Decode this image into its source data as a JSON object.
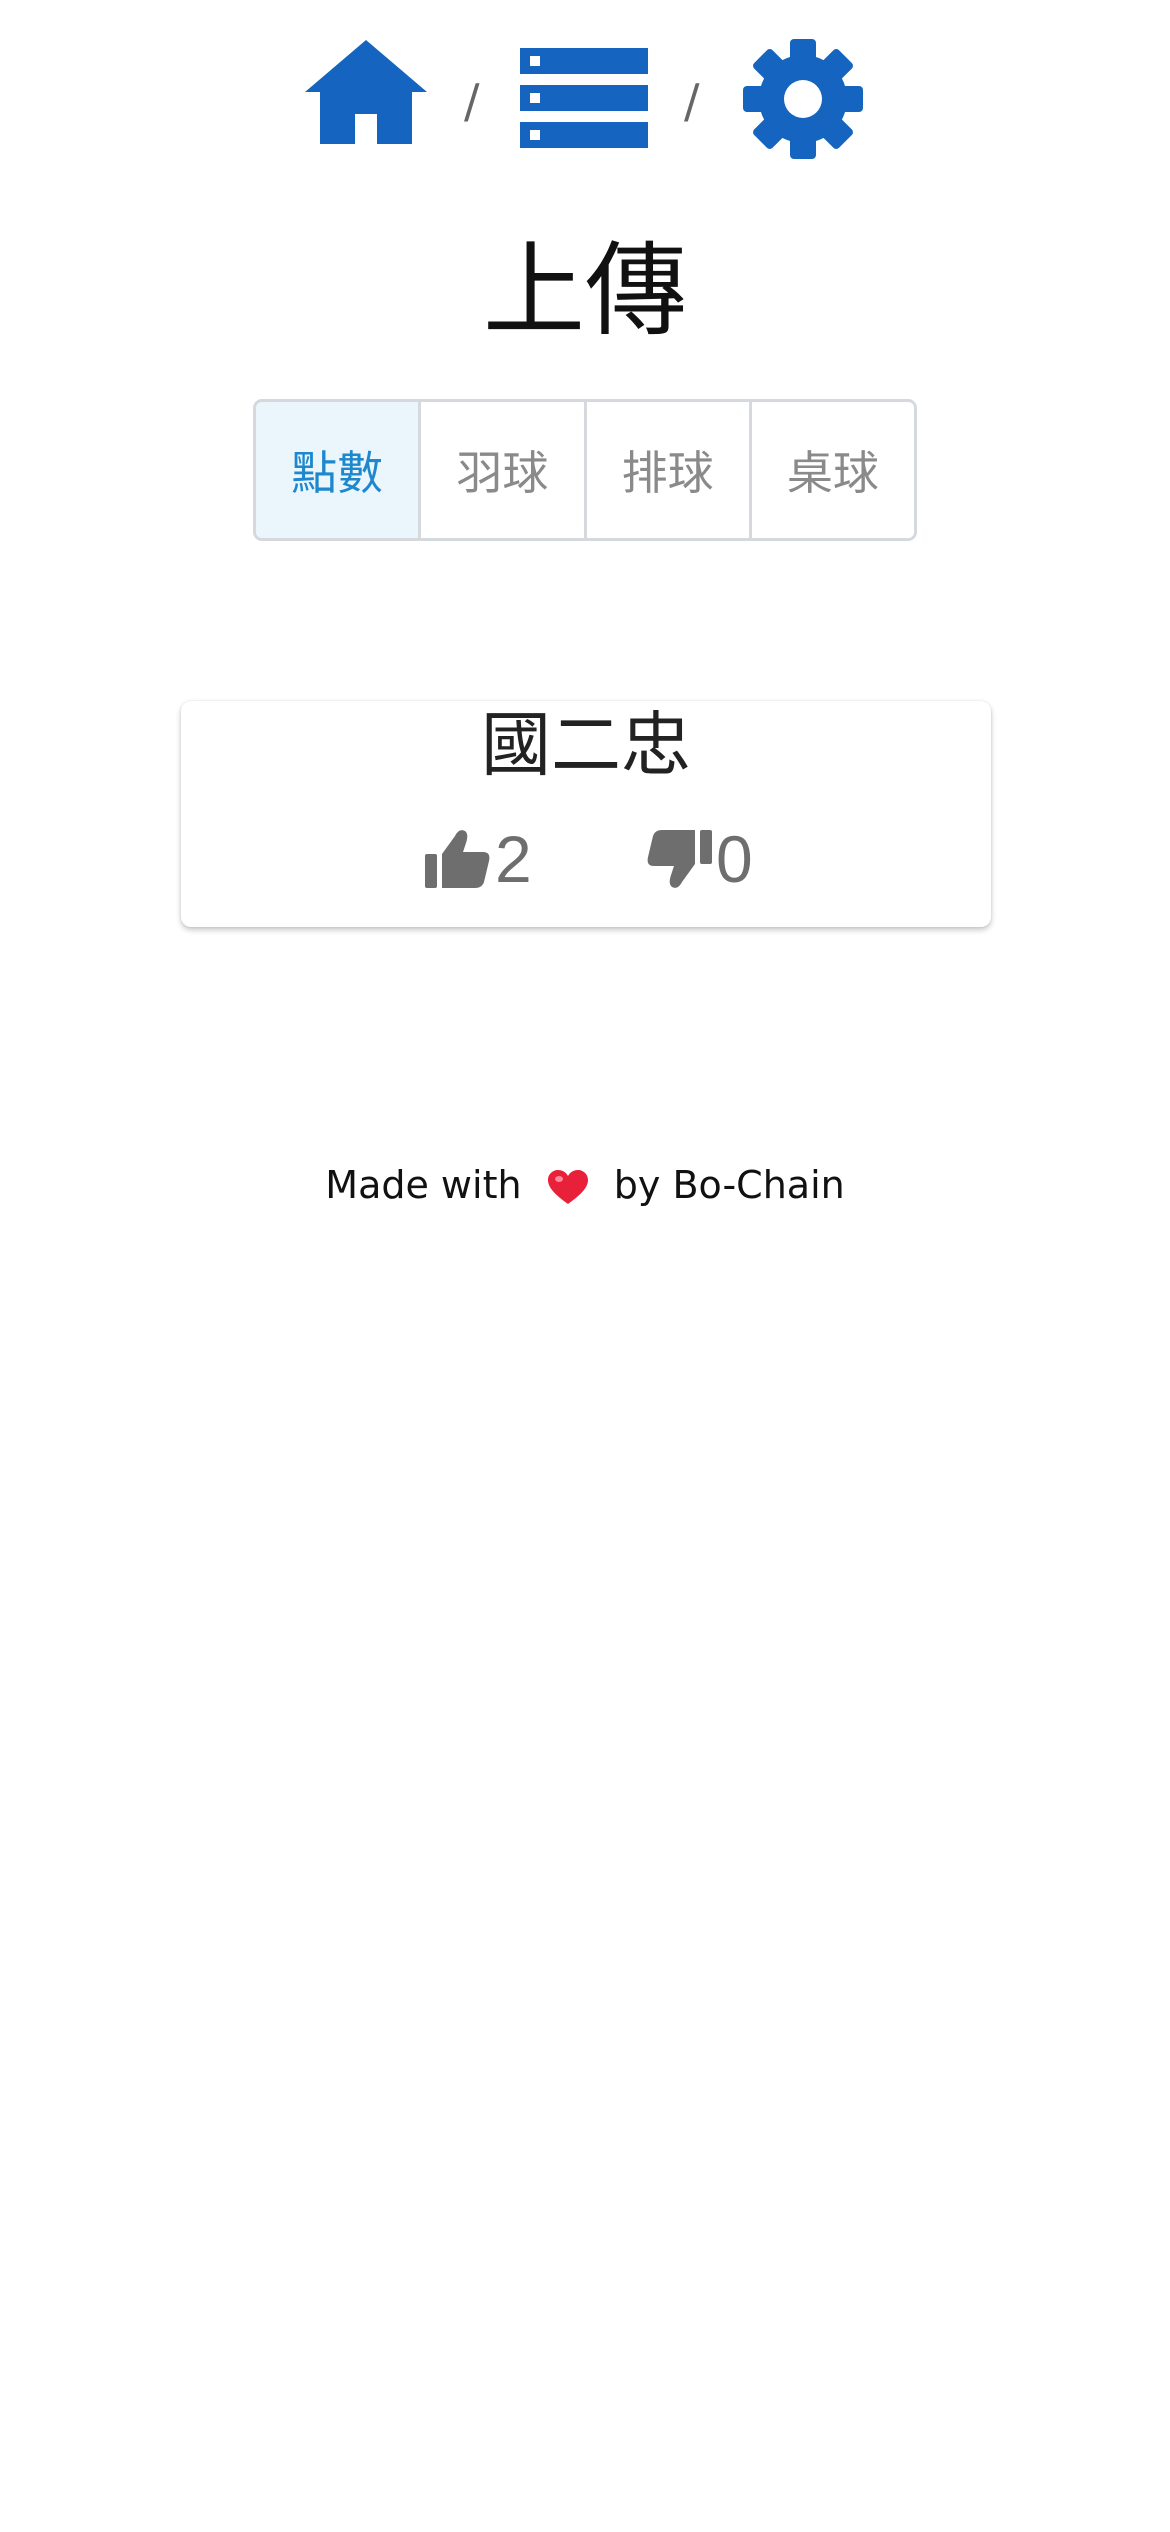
{
  "nav": {
    "home_icon": "home-icon",
    "list_icon": "list-icon",
    "settings_icon": "gear-icon",
    "separator": "/",
    "icon_color": "#1565c0"
  },
  "page": {
    "title": "上傳"
  },
  "tabs": [
    {
      "label": "點數",
      "active": true
    },
    {
      "label": "羽球",
      "active": false
    },
    {
      "label": "排球",
      "active": false
    },
    {
      "label": "桌球",
      "active": false
    }
  ],
  "card": {
    "title": "國二忠",
    "likes": "2",
    "dislikes": "0",
    "like_icon": "thumbs-up-icon",
    "dislike_icon": "thumbs-down-icon"
  },
  "footer": {
    "prefix": "Made with",
    "heart_icon": "heart-icon",
    "suffix": "by Bo-Chain",
    "heart_color": "#e8203a"
  },
  "colors": {
    "accent": "#1565c0",
    "tab_active_text": "#1e88cf",
    "tab_active_bg": "#eaf5fc"
  }
}
